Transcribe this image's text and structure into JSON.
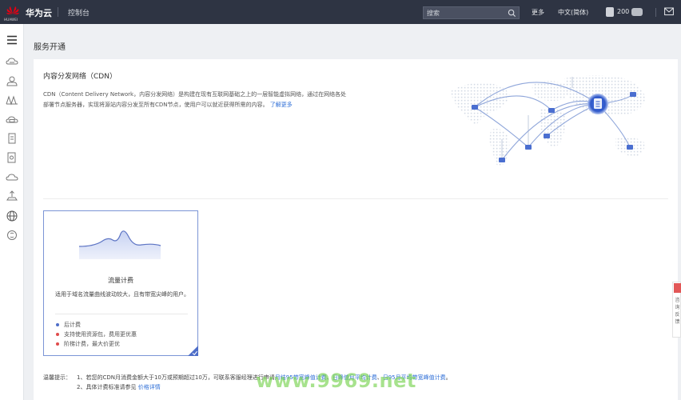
{
  "topbar": {
    "logo_text": "HUAWEI",
    "brand": "华为云",
    "console_label": "控制台",
    "search_placeholder": "搜索",
    "more_label": "更多",
    "language_label": "中文(简体)",
    "user_partial": "200"
  },
  "sidebar": {
    "icons": [
      "menu-icon",
      "cloud-server-icon",
      "cube-icon",
      "network-icon",
      "cloud-database-icon",
      "file-icon",
      "document-icon",
      "cloud-icon",
      "upload-icon",
      "globe-icon",
      "disc-icon"
    ]
  },
  "page": {
    "title": "服务开通"
  },
  "intro": {
    "title": "内容分发网络（CDN）",
    "description": "CDN（Content Delivery Network，内容分发网络）是构建在现有互联网基础之上的一层智能虚拟网络，通过在网络各处部署节点服务器，实现将源站内容分发至所有CDN节点，使用户可以就近获得所需的内容。",
    "learn_more": "了解更多"
  },
  "billing_card": {
    "title": "流量计费",
    "description": "适用于域名流量曲线波动较大，且有带宽尖峰的用户。",
    "features": [
      "后计费",
      "支持使用资源包，费用更优惠",
      "阶梯计费，最大价更优"
    ]
  },
  "tips": {
    "label": "温馨提示：",
    "line1_number": "1、",
    "line1_text": "若您的CDN月消费金额大于10万或预期超过10万，可联系客服经理进行申请",
    "line1_link1": "月结95带宽峰值计费",
    "line1_link2": "日峰值月平均计费",
    "line1_link3": "日95月平均带宽峰值计费",
    "line2_number": "2、",
    "line2_text": "具体计费标准请参见",
    "line2_link": "价格详情"
  },
  "float_widget": {
    "text": "咨询反馈"
  },
  "watermark": "www.9969.net",
  "colors": {
    "topbar_bg": "#2e3443",
    "accent": "#2f6fd7",
    "card_border": "#7b95d6",
    "red": "#e04b4b"
  }
}
